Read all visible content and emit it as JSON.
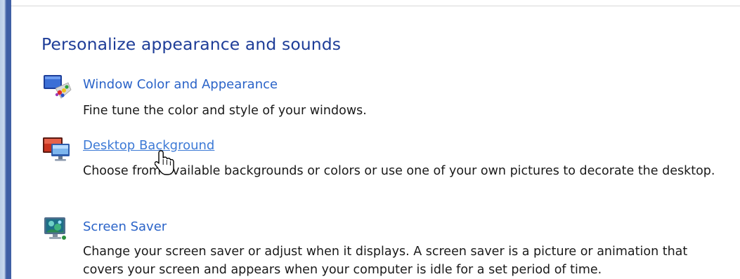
{
  "section": {
    "title": "Personalize appearance and sounds"
  },
  "tasks": [
    {
      "link": "Window Color and Appearance",
      "description": "Fine tune the color and style of your windows.",
      "icon": "window-color-icon"
    },
    {
      "link": "Desktop Background",
      "description": "Choose from available backgrounds or colors or use one of your own pictures to decorate the desktop.",
      "icon": "desktop-background-icon"
    },
    {
      "link": "Screen Saver",
      "description": "Change your screen saver or adjust when it displays. A screen saver is a picture or animation that covers your screen and appears when your computer is idle for a set period of time.",
      "icon": "screen-saver-icon"
    }
  ],
  "colors": {
    "title": "#1e3d98",
    "link": "#2a63c8",
    "link_hover": "#3d7ad6",
    "accent_bar": "#3f5fa5"
  },
  "cursor": "hand-pointer-icon"
}
